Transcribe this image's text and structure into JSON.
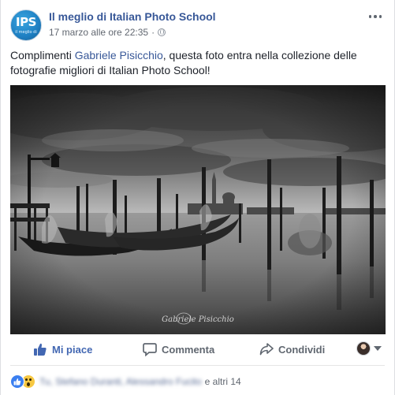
{
  "post": {
    "page_name": "Il meglio di Italian Photo School",
    "timestamp": "17 marzo alle ore 22:35",
    "separator": "·",
    "avatar": {
      "logo_text": "IPS",
      "sub_text": "il meglio di"
    },
    "text_before": "Complimenti ",
    "mention": "Gabriele Pisicchio",
    "text_after": ", questa foto entra nella collezione delle fotografie migliori di Italian Photo School!",
    "photo": {
      "description_icon": "venice-gondolas-photo",
      "signature": "Gabriele Pisicchio"
    }
  },
  "actions": {
    "like_label": "Mi piace",
    "comment_label": "Commenta",
    "share_label": "Condividi"
  },
  "reactions": {
    "names_blurred": "Tu, Stefano Duranti, Alessandro Fucito",
    "others": "e altri 14",
    "icons": [
      "like-icon",
      "wow-icon"
    ]
  },
  "colors": {
    "link": "#385898",
    "like_active": "#4267b2",
    "secondary_text": "#606770"
  }
}
